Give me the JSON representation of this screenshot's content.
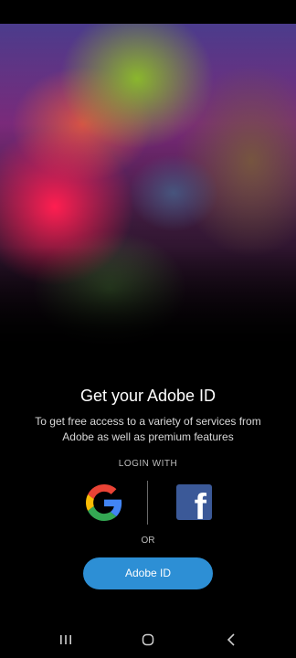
{
  "hero": {
    "image": "woman-neon-face-paint-photo"
  },
  "onboarding": {
    "title": "Get your Adobe ID",
    "subtitle": "To get free access to a variety of services from Adobe as well as premium features",
    "login_with_label": "LOGIN WITH",
    "or_label": "OR",
    "adobe_id_button": "Adobe ID"
  },
  "social_login": {
    "google_icon": "google-logo",
    "facebook_icon": "facebook-logo",
    "facebook_color": "#3B5998"
  },
  "colors": {
    "accent": "#2D8FD5",
    "background": "#000000"
  },
  "nav": {
    "icons": [
      "recent-apps-icon",
      "home-icon",
      "back-icon"
    ]
  }
}
